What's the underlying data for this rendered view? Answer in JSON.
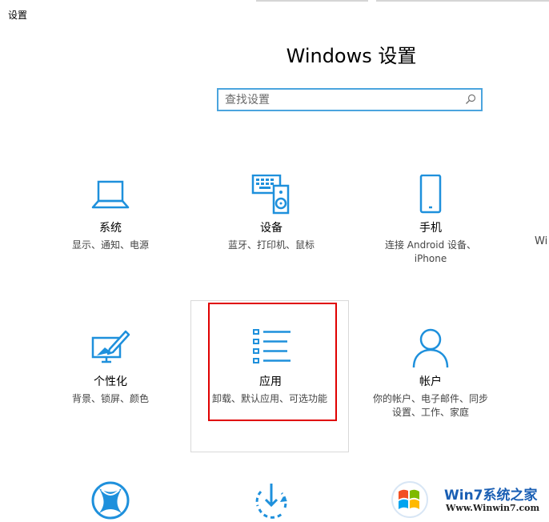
{
  "window": {
    "title": "设置"
  },
  "header": {
    "title": "Windows 设置"
  },
  "search": {
    "placeholder": "查找设置"
  },
  "tiles": [
    {
      "name": "系统",
      "desc": "显示、通知、电源",
      "icon": "laptop-icon"
    },
    {
      "name": "设备",
      "desc": "蓝牙、打印机、鼠标",
      "icon": "devices-icon"
    },
    {
      "name": "手机",
      "desc_lines": [
        "连接 Android 设备、",
        "iPhone"
      ],
      "icon": "phone-icon"
    },
    {
      "name": "个性化",
      "desc": "背景、锁屏、颜色",
      "icon": "personalization-icon"
    },
    {
      "name": "应用",
      "desc": "卸载、默认应用、可选功能",
      "icon": "apps-list-icon"
    },
    {
      "name": "帐户",
      "desc_lines": [
        "你的帐户、电子邮件、同步",
        "设置、工作、家庭"
      ],
      "icon": "account-icon"
    }
  ],
  "partial": {
    "right_cut_text": "Wi"
  },
  "watermark": {
    "brand": "Win7系统之家",
    "url": "Www.Winwin7.com"
  },
  "colors": {
    "accent": "#1e90dc",
    "highlight_border": "#e00000"
  }
}
